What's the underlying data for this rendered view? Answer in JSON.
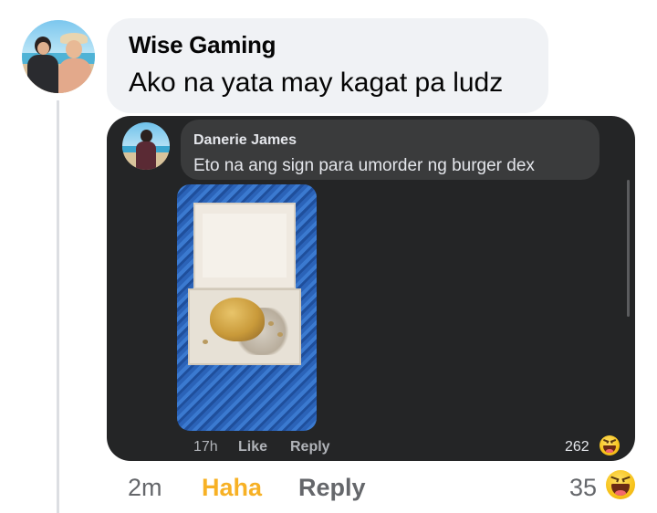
{
  "comment": {
    "author": "Wise Gaming",
    "text": "Ako na yata may kagat pa ludz",
    "time": "2m",
    "reaction_action": "Haha",
    "reply_label": "Reply",
    "reaction_count": "35",
    "reaction_icon": "haha-icon"
  },
  "embedded_comment": {
    "author": "Danerie James",
    "text": "Eto na ang sign para umorder ng burger dex",
    "time": "17h",
    "like_label": "Like",
    "reply_label": "Reply",
    "reaction_count": "262",
    "reaction_icon": "haha-icon",
    "photo": "burger-box-photo"
  },
  "colors": {
    "haha_accent": "#f7b125",
    "light_bubble": "#f0f2f5",
    "dark_panel": "#242526",
    "dark_bubble": "#3a3b3c"
  }
}
